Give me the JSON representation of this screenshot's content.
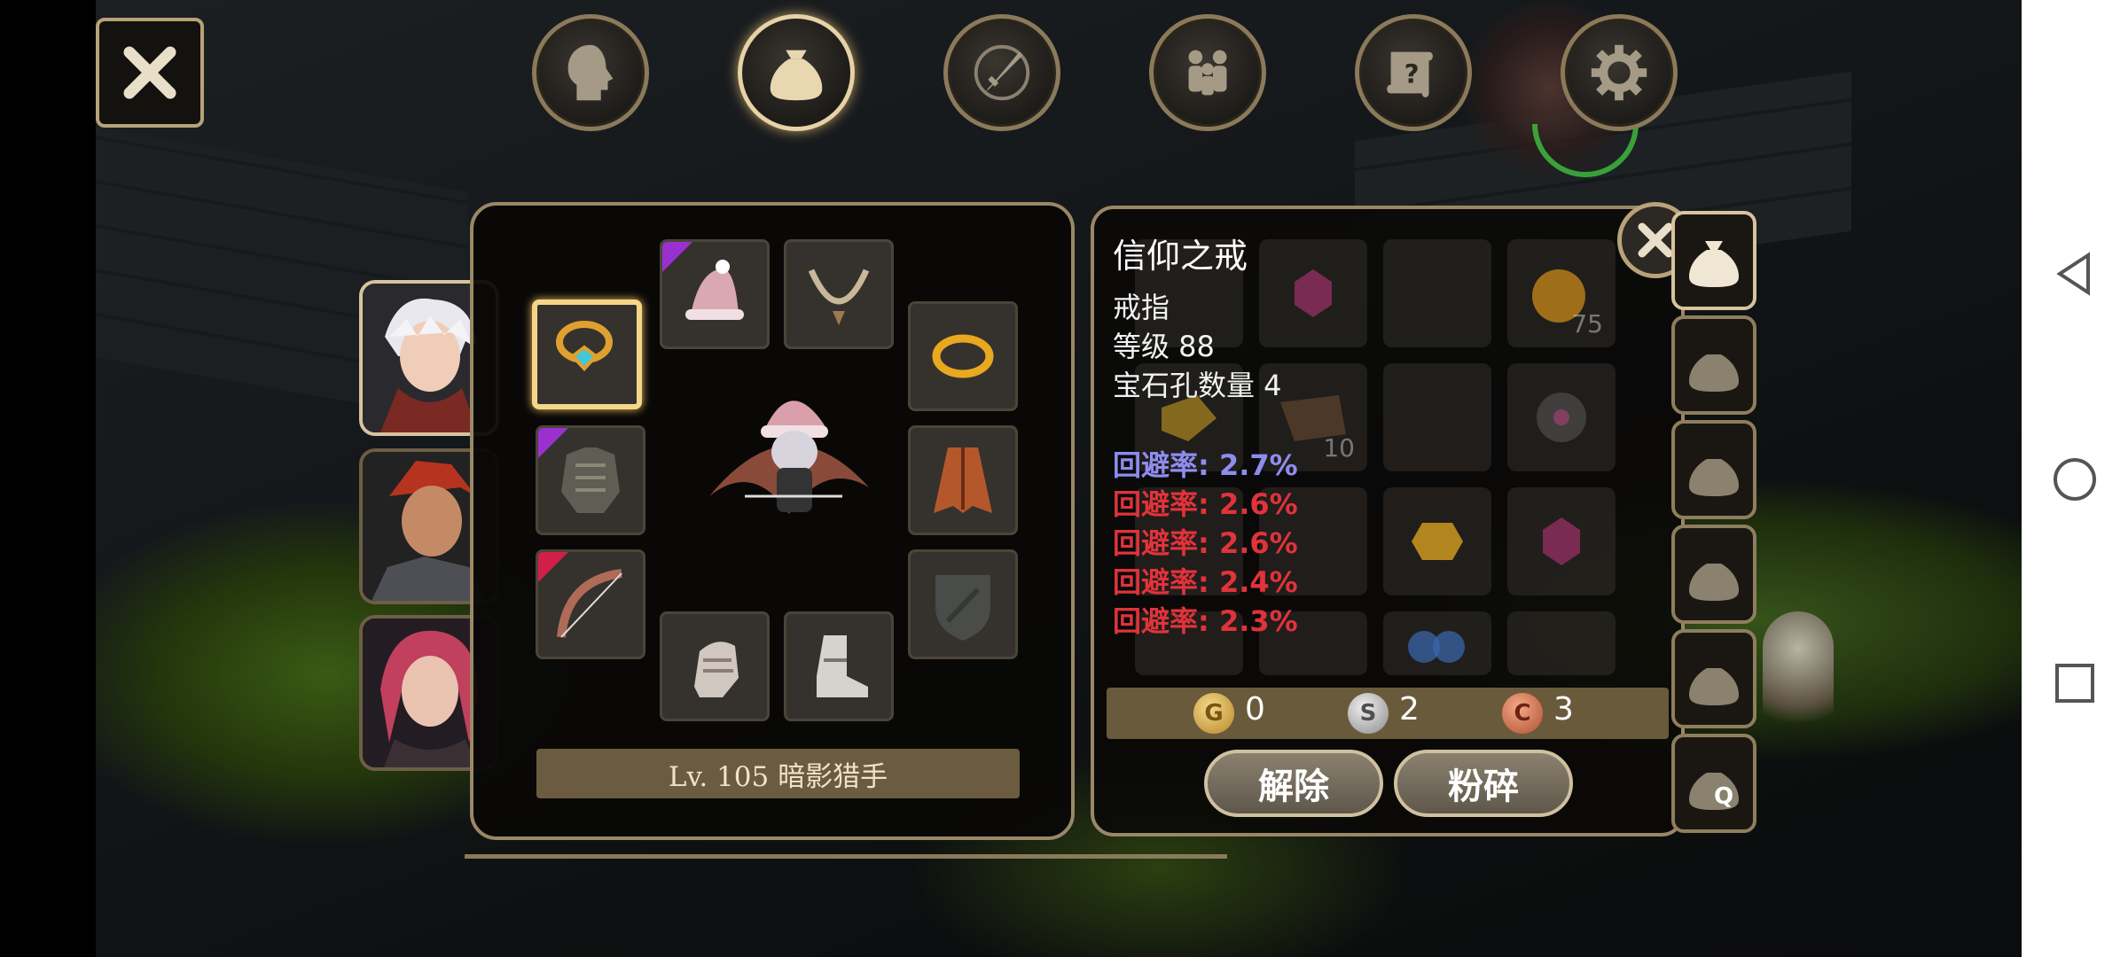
{
  "tabs": [
    "character",
    "inventory",
    "skills",
    "party",
    "quests",
    "settings"
  ],
  "active_tab": "inventory",
  "equipment": {
    "level_label": "Lv. 105 暗影猎手"
  },
  "item": {
    "name": "信仰之戒",
    "type": "戒指",
    "level": "等级 88",
    "sockets": "宝石孔数量 4",
    "stats": [
      {
        "text": "回避率: 2.7%",
        "color": "#8f8cf0"
      },
      {
        "text": "回避率: 2.6%",
        "color": "#e0333a"
      },
      {
        "text": "回避率: 2.6%",
        "color": "#e0333a"
      },
      {
        "text": "回避率: 2.4%",
        "color": "#e0333a"
      },
      {
        "text": "回避率: 2.3%",
        "color": "#e0333a"
      }
    ]
  },
  "inventory_counts": {
    "stack_75": "75",
    "stack_10": "10"
  },
  "currency": {
    "gold": {
      "icon": "G",
      "value": "0"
    },
    "silver": {
      "icon": "S",
      "value": "2"
    },
    "copper": {
      "icon": "C",
      "value": "3"
    }
  },
  "buttons": {
    "unequip": "解除",
    "shatter": "粉碎"
  },
  "side_tab_last": "Q",
  "colors": {
    "panel_border": "#9a8766",
    "selected_slot": "#f3d68a",
    "rare_purple": "#9b30d0",
    "rare_red": "#d02048"
  }
}
